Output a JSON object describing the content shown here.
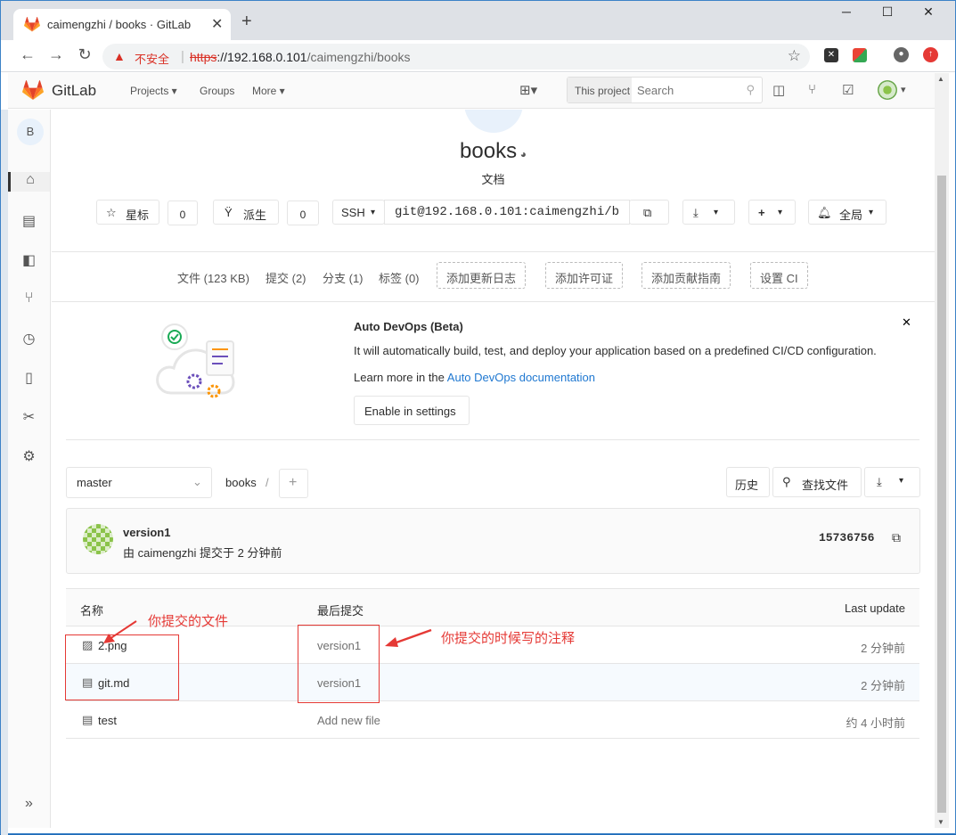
{
  "browser": {
    "tab_title": "caimengzhi / books · GitLab",
    "tab_close": "✕",
    "new_tab": "+",
    "insecure_label": "不安全",
    "url_scheme": "https",
    "url_rest": "://192.168.0.101",
    "url_path": "/caimengzhi/books",
    "window_minimize": "─",
    "window_maximize": "☐",
    "window_close": "✕"
  },
  "gitlab_header": {
    "brand": "GitLab",
    "nav": {
      "projects": "Projects ▾",
      "groups": "Groups",
      "more": "More ▾"
    },
    "search_scope": "This project",
    "search_placeholder": "Search"
  },
  "sidebar": {
    "project_initial": "B"
  },
  "project": {
    "name": "books",
    "description": "文档",
    "star_label": "星标",
    "star_count": "0",
    "fork_label": "派生",
    "fork_count": "0",
    "protocol": "SSH",
    "clone_url": "git@192.168.0.101:caimengzhi/b",
    "notification_label": "全局"
  },
  "stats": {
    "files": "文件 (123 KB)",
    "commits": "提交 (2)",
    "branches": "分支 (1)",
    "tags": "标签 (0)",
    "add_changelog": "添加更新日志",
    "add_license": "添加许可证",
    "add_contributing": "添加贡献指南",
    "setup_ci": "设置 CI"
  },
  "devops": {
    "title": "Auto DevOps (Beta)",
    "body": "It will automatically build, test, and deploy your application based on a predefined CI/CD configuration.",
    "learn_prefix": "Learn more in the ",
    "learn_link": "Auto DevOps documentation",
    "enable_button": "Enable in settings",
    "close": "✕"
  },
  "repo_toolbar": {
    "branch": "master",
    "breadcrumb": "books",
    "breadcrumb_sep": "/",
    "history": "历史",
    "find_file": "查找文件"
  },
  "last_commit": {
    "title": "version1",
    "meta": "由 caimengzhi 提交于 2 分钟前",
    "sha": "15736756"
  },
  "file_table": {
    "headers": {
      "name": "名称",
      "last_commit": "最后提交",
      "last_update": "Last update"
    },
    "rows": [
      {
        "name": "2.png",
        "commit": "version1",
        "time": "2 分钟前",
        "icon": "image-file-icon"
      },
      {
        "name": "git.md",
        "commit": "version1",
        "time": "2 分钟前",
        "icon": "file-icon"
      },
      {
        "name": "test",
        "commit": "Add new file",
        "time": "约 4 小时前",
        "icon": "file-icon"
      }
    ]
  },
  "annotations": {
    "files_note": "你提交的文件",
    "comment_note": "你提交的时候写的注释"
  },
  "colors": {
    "accent_red": "#e53935",
    "link_blue": "#1f78d1",
    "gitlab_orange": "#e24329"
  }
}
